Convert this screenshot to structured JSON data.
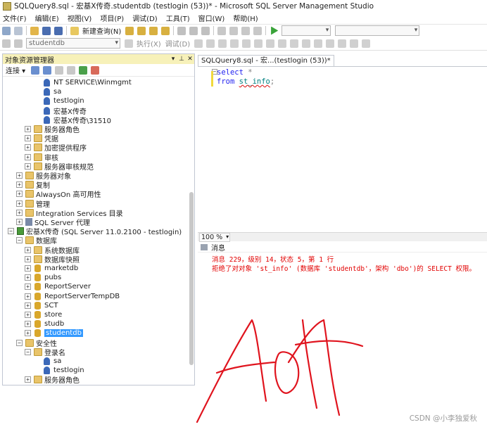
{
  "window": {
    "title": "SQLQuery8.sql - 宏基X传奇.studentdb (testlogin (53))* - Microsoft SQL Server Management Studio"
  },
  "menu": [
    "文件(F)",
    "编辑(E)",
    "视图(V)",
    "项目(P)",
    "调试(D)",
    "工具(T)",
    "窗口(W)",
    "帮助(H)"
  ],
  "toolbar": {
    "new_query": "新建查询(N)",
    "database_combo": "studentdb",
    "execute": "执行(X)",
    "debug": "调试(D)"
  },
  "object_explorer": {
    "title": "对象资源管理器",
    "pin_glyph": "▾ ⫰ ✕",
    "connect_label": "连接 ▾",
    "tree": [
      {
        "label": "NT SERVICE\\Winmgmt",
        "icon": "user-icon"
      },
      {
        "label": "sa",
        "icon": "user-icon"
      },
      {
        "label": "testlogin",
        "icon": "user-icon"
      },
      {
        "label": "宏基X传奇",
        "icon": "user-icon"
      },
      {
        "label": "宏基X传奇\\31510",
        "icon": "user-icon"
      },
      {
        "label": "服务器角色",
        "icon": "folder-icon",
        "expander": "+"
      },
      {
        "label": "凭据",
        "icon": "folder-icon",
        "expander": "+"
      },
      {
        "label": "加密提供程序",
        "icon": "folder-icon",
        "expander": "+"
      },
      {
        "label": "审核",
        "icon": "folder-icon",
        "expander": "+"
      },
      {
        "label": "服务器审核规范",
        "icon": "folder-icon",
        "expander": "+"
      },
      {
        "label": "服务器对象",
        "icon": "folder-icon",
        "expander": "+"
      },
      {
        "label": "复制",
        "icon": "folder-icon",
        "expander": "+"
      },
      {
        "label": "AlwaysOn 高可用性",
        "icon": "folder-icon",
        "expander": "+"
      },
      {
        "label": "管理",
        "icon": "folder-icon",
        "expander": "+"
      },
      {
        "label": "Integration Services 目录",
        "icon": "folder-icon",
        "expander": "+"
      },
      {
        "label": "SQL Server 代理",
        "icon": "agent-icon",
        "expander": "+"
      },
      {
        "label": "宏基X传奇 (SQL Server 11.0.2100 - testlogin)",
        "icon": "server-icon",
        "expander": "−"
      },
      {
        "label": "数据库",
        "icon": "folder-icon",
        "expander": "−"
      },
      {
        "label": "系统数据库",
        "icon": "folder-icon",
        "expander": "+"
      },
      {
        "label": "数据库快照",
        "icon": "folder-icon",
        "expander": "+"
      },
      {
        "label": "marketdb",
        "icon": "database-icon",
        "expander": "+"
      },
      {
        "label": "pubs",
        "icon": "database-icon",
        "expander": "+"
      },
      {
        "label": "ReportServer",
        "icon": "database-icon",
        "expander": "+"
      },
      {
        "label": "ReportServerTempDB",
        "icon": "database-icon",
        "expander": "+"
      },
      {
        "label": "SCT",
        "icon": "database-icon",
        "expander": "+"
      },
      {
        "label": "store",
        "icon": "database-icon",
        "expander": "+"
      },
      {
        "label": "studb",
        "icon": "database-icon",
        "expander": "+"
      },
      {
        "label": "studentdb",
        "icon": "database-icon",
        "expander": "+",
        "selected": true
      },
      {
        "label": "安全性",
        "icon": "folder-icon",
        "expander": "−"
      },
      {
        "label": "登录名",
        "icon": "folder-icon",
        "expander": "−"
      },
      {
        "label": "sa",
        "icon": "user-icon"
      },
      {
        "label": "testlogin",
        "icon": "user-icon"
      },
      {
        "label": "服务器角色",
        "icon": "folder-icon",
        "expander": "+"
      }
    ]
  },
  "editor": {
    "tab_label": "SQLQuery8.sql - 宏...(testlogin (53))*",
    "line1_kw": "select",
    "line1_rest": " *",
    "line2_kw": "from",
    "line2_obj": "st_info",
    "line2_end": ";"
  },
  "results": {
    "zoom": "100 %",
    "tab_label": "消息",
    "message_line1": "消息 229，级别 14，状态 5，第 1 行",
    "message_line2": "拒绝了对对象 'st_info' (数据库 'studentdb'，架构 'dbo')的 SELECT 权限。"
  },
  "watermark": "CSDN @小李独爱秋",
  "colors": {
    "selection": "#3399ff",
    "error_text": "#e20000",
    "keyword": "#1d1df0",
    "panel_header": "#f7f1b9",
    "scribble": "#e0141e"
  }
}
